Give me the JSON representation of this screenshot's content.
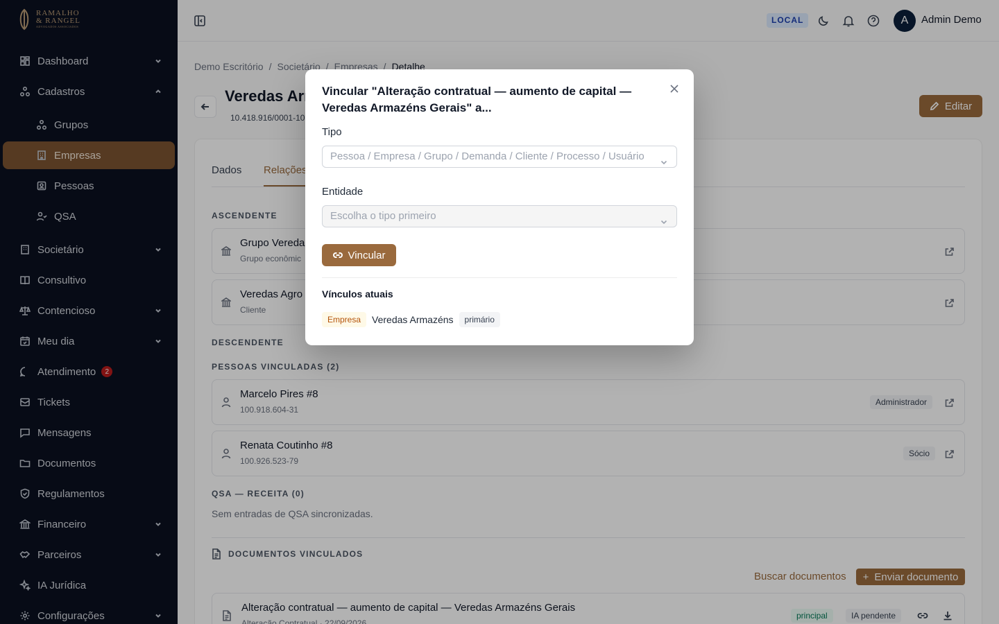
{
  "brand": {
    "line1": "RAMALHO",
    "line2": "& RANGEL",
    "tagline": "ADVOGADOS ASSOCIADOS"
  },
  "sidebar": {
    "items": [
      {
        "label": "Dashboard",
        "icon": "dashboard-icon"
      },
      {
        "label": "Cadastros",
        "icon": "network-icon"
      },
      {
        "label": "Grupos",
        "icon": "network-icon"
      },
      {
        "label": "Empresas",
        "icon": "building-icon"
      },
      {
        "label": "Pessoas",
        "icon": "contact-icon"
      },
      {
        "label": "QSA",
        "icon": "user-check-icon"
      },
      {
        "label": "Societário",
        "icon": "building-icon"
      },
      {
        "label": "Consultivo",
        "icon": "book-icon"
      },
      {
        "label": "Contencioso",
        "icon": "scale-icon"
      },
      {
        "label": "Meu dia",
        "icon": "calendar-icon"
      },
      {
        "label": "Atendimento",
        "icon": "chat-icon",
        "badge": "2"
      },
      {
        "label": "Tickets",
        "icon": "ticket-icon"
      },
      {
        "label": "Mensagens",
        "icon": "message-icon"
      },
      {
        "label": "Documentos",
        "icon": "folder-icon"
      },
      {
        "label": "Regulamentos",
        "icon": "shield-icon"
      },
      {
        "label": "Financeiro",
        "icon": "bank-icon"
      },
      {
        "label": "Parceiros",
        "icon": "handshake-icon"
      },
      {
        "label": "IA Jurídica",
        "icon": "sparkle-icon"
      },
      {
        "label": "Configurações",
        "icon": "gear-icon"
      }
    ]
  },
  "topbar": {
    "env": "LOCAL",
    "avatar_initial": "A",
    "user_name": "Admin Demo"
  },
  "breadcrumb": [
    "Demo Escritório",
    "Societário",
    "Empresas",
    "Detalhe"
  ],
  "breadcrumb_sep": "/",
  "page": {
    "title": "Veredas Arm",
    "cnpj": "10.418.916/0001-10",
    "edit_label": "Editar"
  },
  "tabs": [
    "Dados",
    "Relações"
  ],
  "sections": {
    "ascendente": "ASCENDENTE",
    "descendente": "DESCENDENTE",
    "pessoas": "PESSOAS VINCULADAS (2)",
    "qsa": "QSA — RECEITA (0)",
    "qsa_empty": "Sem entradas de QSA sincronizadas.",
    "docs": "DOCUMENTOS VINCULADOS"
  },
  "ascendentes": [
    {
      "name": "Grupo Vereda",
      "sub": "Grupo econômic"
    },
    {
      "name": "Veredas Agro",
      "sub": "Cliente"
    }
  ],
  "pessoas": [
    {
      "name": "Marcelo Pires #8",
      "doc": "100.918.604-31",
      "role": "Administrador"
    },
    {
      "name": "Renata Coutinho #8",
      "doc": "100.926.523-79",
      "role": "Sócio"
    }
  ],
  "docs": {
    "search_label": "Buscar documentos",
    "send_label": "Enviar documento",
    "items": [
      {
        "title": "Alteração contratual — aumento de capital — Veredas Armazéns Gerais",
        "sub": "Alteração Contratual · 22/09/2026",
        "tag1": "principal",
        "tag2": "IA pendente"
      }
    ]
  },
  "modal": {
    "title": "Vincular \"Alteração contratual — aumento de capital — Veredas Armazéns Gerais\" a...",
    "tipo_label": "Tipo",
    "tipo_placeholder": "Pessoa / Empresa / Grupo / Demanda / Cliente / Processo / Usuário",
    "entidade_label": "Entidade",
    "entidade_placeholder": "Escolha o tipo primeiro",
    "submit_label": "Vincular",
    "current_heading": "Vínculos atuais",
    "current": [
      {
        "type": "Empresa",
        "name": "Veredas Armazéns",
        "flag": "primário"
      }
    ]
  },
  "colors": {
    "accent": "#9a6a3d",
    "sidebar_bg": "#0b1120",
    "active_bg": "#7b5331"
  }
}
